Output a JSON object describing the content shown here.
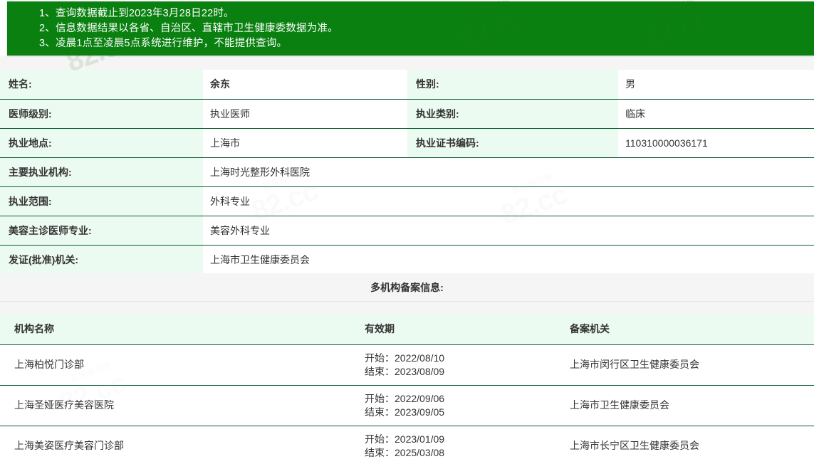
{
  "notice": {
    "lines": [
      "1、查询数据截止到2023年3月28日22时。",
      "2、信息数据结果以各省、自治区、直辖市卫生健康委数据为准。",
      "3、凌晨1点至凌晨5点系统进行维护，不能提供查询。"
    ],
    "background_color": "#0a8010",
    "text_color": "#ffffff"
  },
  "watermark": {
    "main_text": "82.cc",
    "sub_text": "医院排行榜"
  },
  "colors": {
    "label_cell_background": "#ecfbf1",
    "row_border": "#0a5c2e",
    "section_band_background": "#f5f5f5"
  },
  "info": {
    "rows": [
      {
        "label1": "姓名:",
        "value1": "余东",
        "label2": "性别:",
        "value2": "男"
      },
      {
        "label1": "医师级别:",
        "value1": "执业医师",
        "label2": "执业类别:",
        "value2": "临床"
      },
      {
        "label1": "执业地点:",
        "value1": "上海市",
        "label2": "执业证书编码:",
        "value2": "110310000036171"
      }
    ],
    "wide_rows": [
      {
        "label": "主要执业机构:",
        "value": "上海时光整形外科医院"
      },
      {
        "label": "执业范围:",
        "value": "外科专业"
      },
      {
        "label": "美容主诊医师专业:",
        "value": "美容外科专业"
      },
      {
        "label": "发证(批准)机关:",
        "value": "上海市卫生健康委员会"
      }
    ]
  },
  "section": {
    "title": "多机构备案信息:"
  },
  "records": {
    "headers": [
      "机构名称",
      "有效期",
      "备案机关"
    ],
    "start_label": "开始：",
    "end_label": "结束：",
    "rows": [
      {
        "name": "上海柏悦门诊部",
        "start": "开始：2022/08/10",
        "end": "结束：2023/08/09",
        "authority": "上海市闵行区卫生健康委员会"
      },
      {
        "name": "上海圣娅医疗美容医院",
        "start": "开始：2022/09/06",
        "end": "结束：2023/09/05",
        "authority": "上海市卫生健康委员会"
      },
      {
        "name": "上海美姿医疗美容门诊部",
        "start": "开始：2023/01/09",
        "end": "结束：2025/03/08",
        "authority": "上海市长宁区卫生健康委员会"
      }
    ]
  }
}
